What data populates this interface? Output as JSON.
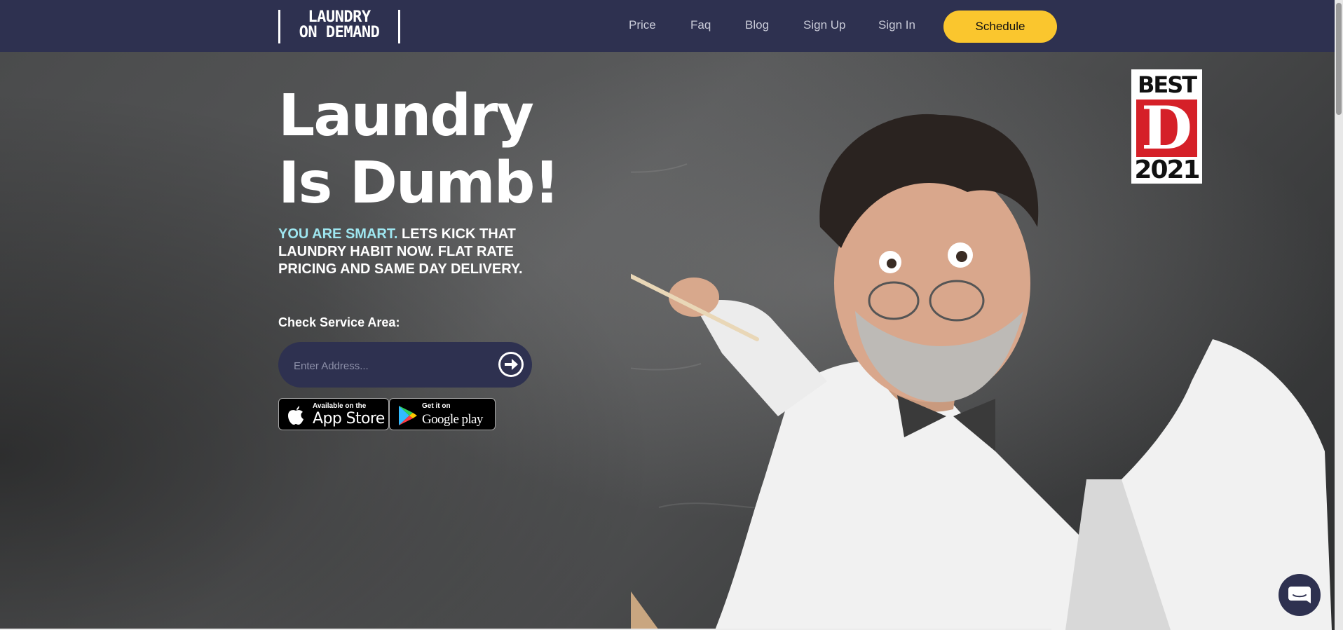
{
  "logo": {
    "line1": "LAUNDRY",
    "line2": "ON DEMAND"
  },
  "nav": {
    "links": [
      "Price",
      "Faq",
      "Blog",
      "Sign Up",
      "Sign In"
    ],
    "cta": "Schedule"
  },
  "hero": {
    "headline": "Laundry Is Dumb!",
    "tagline_highlight": "YOU ARE SMART.",
    "tagline_rest": " LETS KICK THAT LAUNDRY HABIT NOW. FLAT RATE PRICING AND SAME DAY DELIVERY.",
    "service_label": "Check Service Area:",
    "address_placeholder": "Enter Address...",
    "address_value": ""
  },
  "stores": {
    "apple": {
      "small": "Available on the",
      "big": "App Store"
    },
    "google": {
      "small": "Get it on",
      "big": "Google play"
    }
  },
  "badge": {
    "top": "BEST",
    "letter": "D",
    "year": "2021"
  },
  "colors": {
    "nav_bg": "#2e3150",
    "cta_bg": "#fac62e",
    "highlight": "#9ee6f0",
    "badge_red": "#d52028"
  }
}
